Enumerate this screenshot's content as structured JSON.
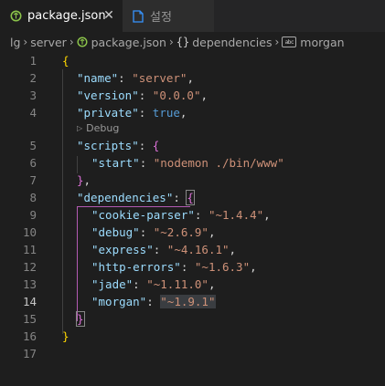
{
  "tabs": [
    {
      "label": "package.json",
      "icon": "json-file-icon",
      "active": true,
      "close": "✕"
    },
    {
      "label": "설정",
      "icon": "settings-file-icon",
      "active": false
    }
  ],
  "breadcrumb": [
    {
      "label": "lg",
      "icon": null
    },
    {
      "label": "server",
      "icon": null
    },
    {
      "label": "package.json",
      "icon": "json-file-icon"
    },
    {
      "label": "dependencies",
      "icon": "braces-icon",
      "icon_text": "{}"
    },
    {
      "label": "morgan",
      "icon": "string-icon",
      "icon_text": "abc"
    }
  ],
  "codelens": {
    "label": "Debug",
    "icon": "play-icon"
  },
  "line_numbers": [
    "1",
    "2",
    "3",
    "4",
    "5",
    "6",
    "7",
    "8",
    "9",
    "10",
    "11",
    "12",
    "13",
    "14",
    "15",
    "16",
    "17"
  ],
  "current_line": "14",
  "code": {
    "l1_open": "{",
    "name_key": "\"name\"",
    "name_val": "\"server\"",
    "version_key": "\"version\"",
    "version_val": "\"0.0.0\"",
    "private_key": "\"private\"",
    "private_val": "true",
    "scripts_key": "\"scripts\"",
    "scripts_open": "{",
    "start_key": "\"start\"",
    "start_val": "\"nodemon ./bin/www\"",
    "scripts_close": "}",
    "deps_key": "\"dependencies\"",
    "deps_open": "{",
    "cookie_key": "\"cookie-parser\"",
    "cookie_val": "\"~1.4.4\"",
    "debug_key": "\"debug\"",
    "debug_val": "\"~2.6.9\"",
    "express_key": "\"express\"",
    "express_val": "\"~4.16.1\"",
    "httperr_key": "\"http-errors\"",
    "httperr_val": "\"~1.6.3\"",
    "jade_key": "\"jade\"",
    "jade_val": "\"~1.11.0\"",
    "morgan_key": "\"morgan\"",
    "morgan_val": "\"~1.9.1\"",
    "deps_close": "}",
    "l16_close": "}",
    "colon": ": ",
    "comma": ","
  }
}
